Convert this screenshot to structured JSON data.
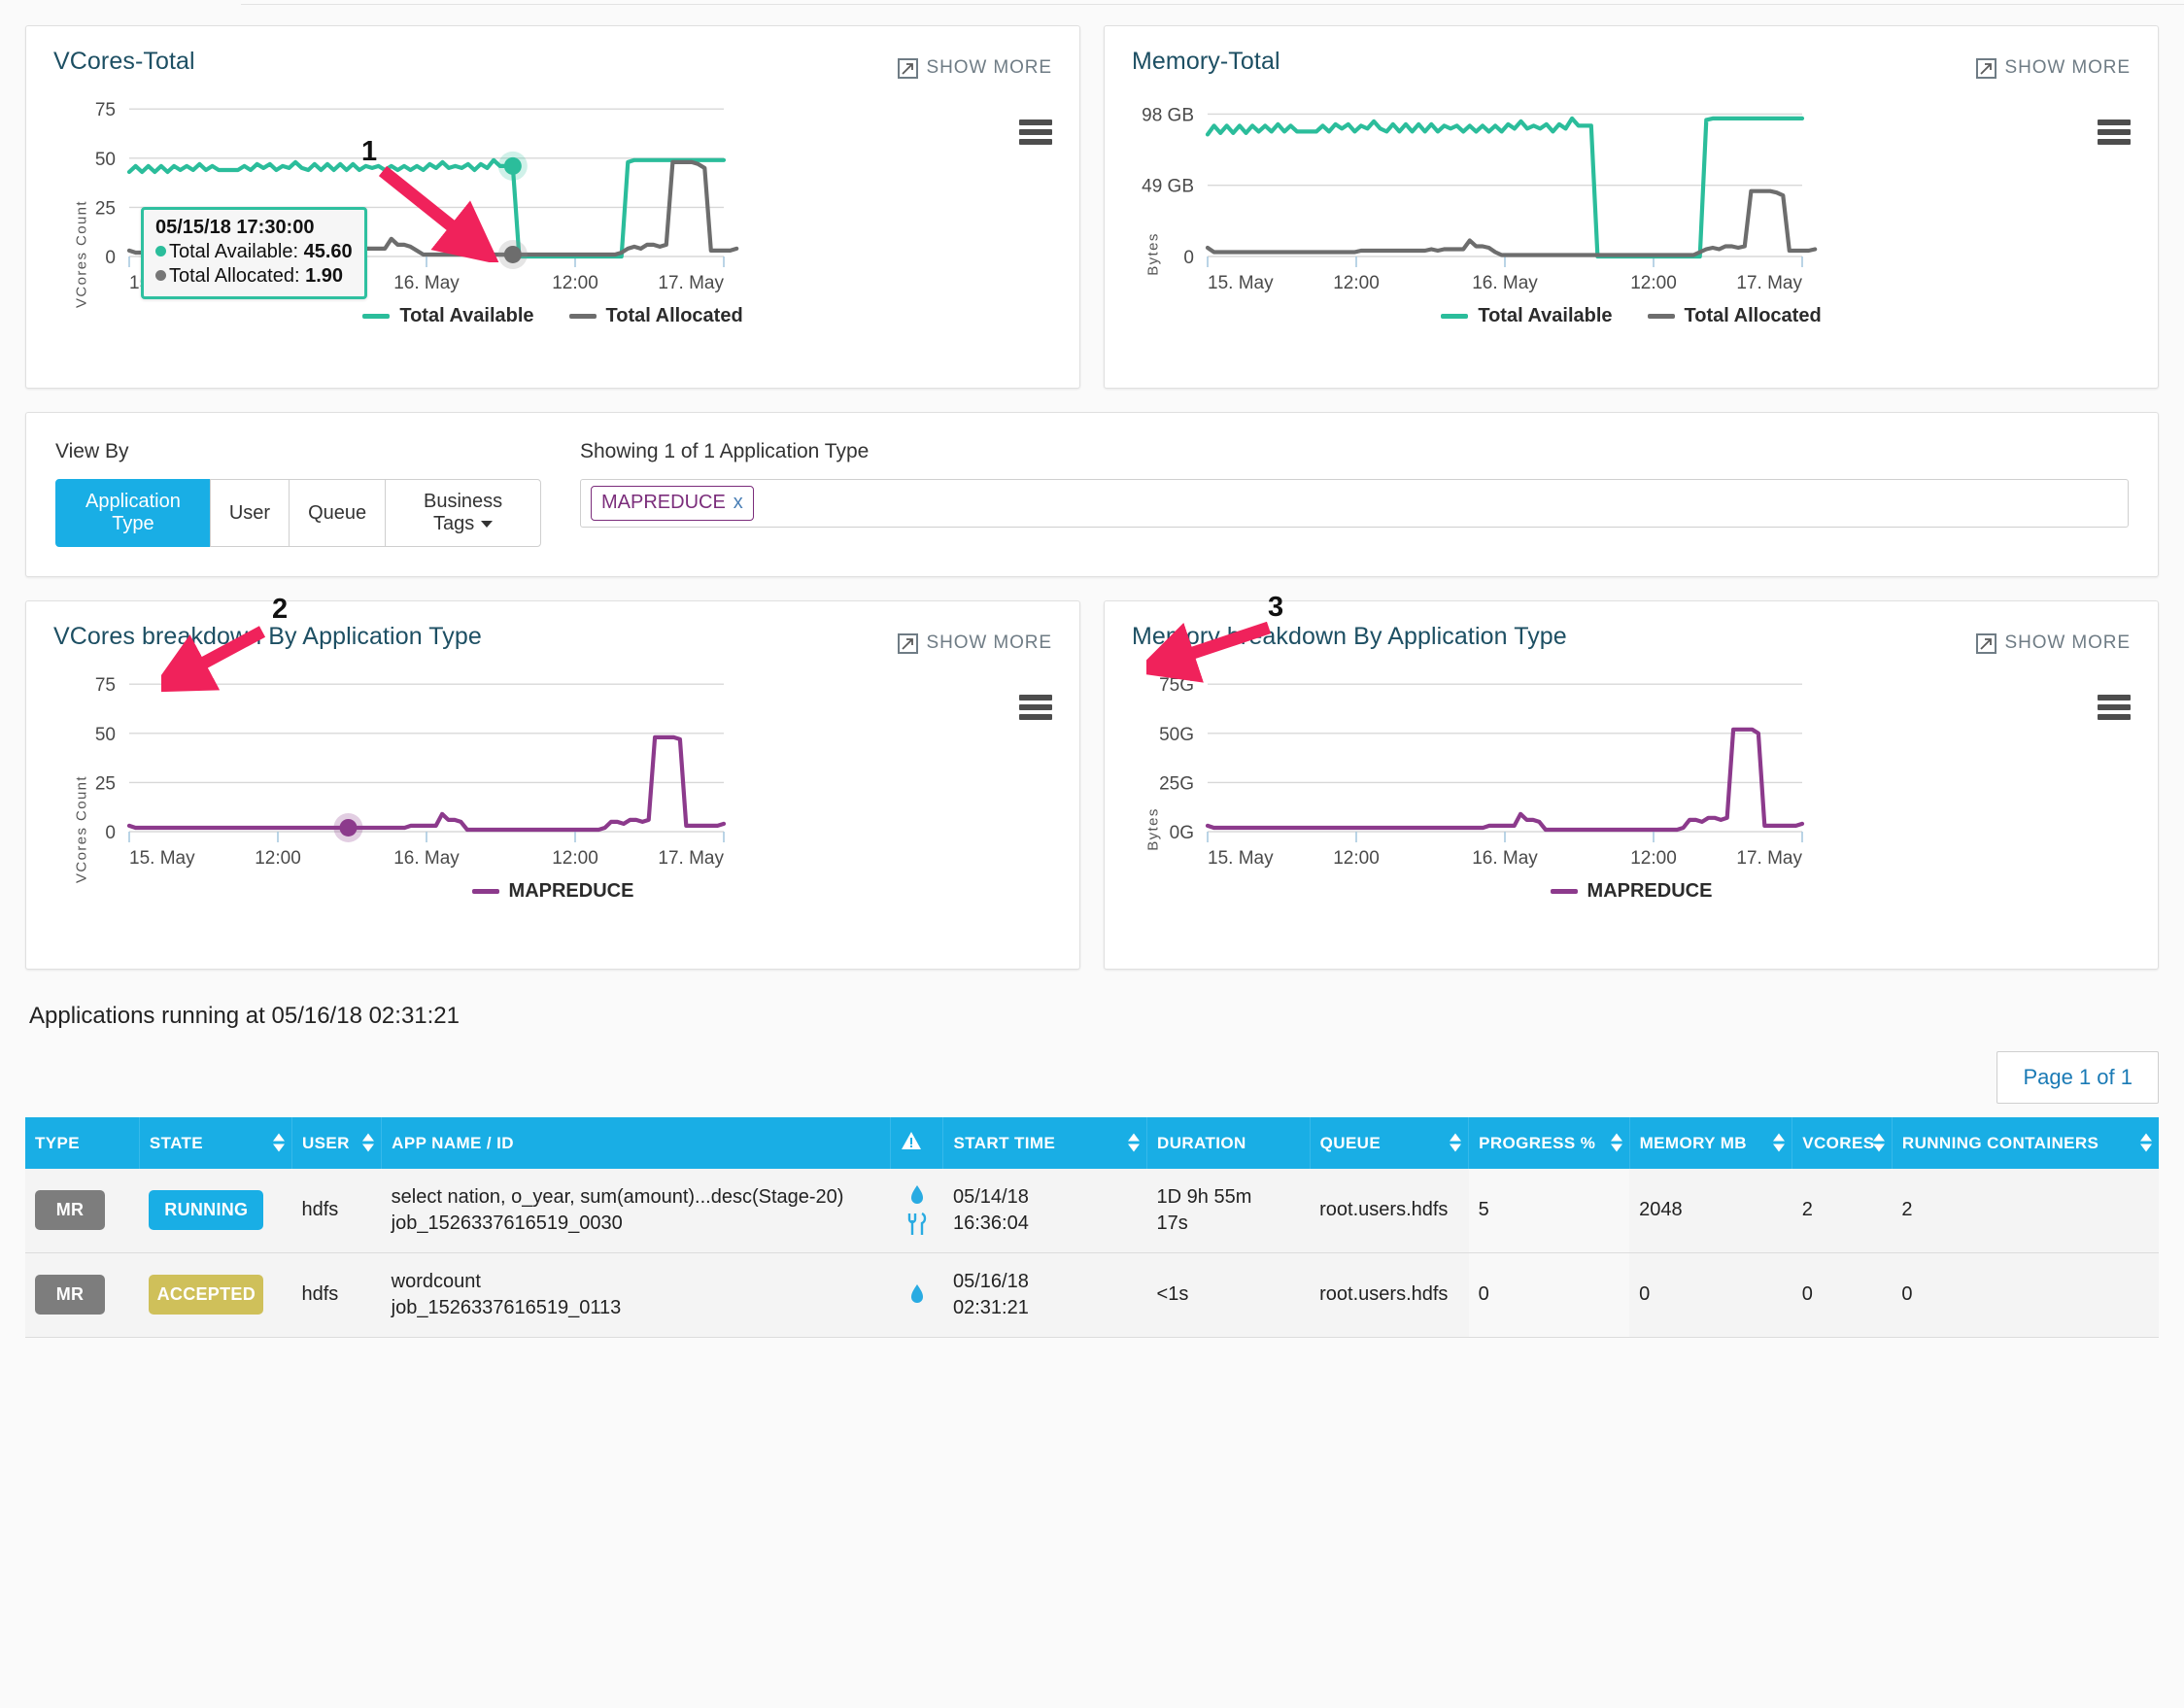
{
  "panels": {
    "vcores_total": {
      "title": "VCores-Total",
      "show_more": "SHOW MORE",
      "menu_icon": "hamburger-icon"
    },
    "memory_total": {
      "title": "Memory-Total",
      "show_more": "SHOW MORE",
      "menu_icon": "hamburger-icon"
    },
    "vcores_breakdown": {
      "title": "VCores breakdown By Application Type",
      "show_more": "SHOW MORE",
      "menu_icon": "hamburger-icon"
    },
    "memory_breakdown": {
      "title": "Memory breakdown By Application Type",
      "show_more": "SHOW MORE",
      "menu_icon": "hamburger-icon"
    }
  },
  "tooltip": {
    "time": "05/15/18 17:30:00",
    "series1_label": "Total Available:",
    "series1_value": "45.60",
    "series2_label": "Total Allocated:",
    "series2_value": "1.90"
  },
  "annotations": [
    {
      "number": "1"
    },
    {
      "number": "2"
    },
    {
      "number": "3"
    }
  ],
  "view_by": {
    "label": "View By",
    "buttons": [
      {
        "label": "Application Type",
        "active": true
      },
      {
        "label": "User",
        "active": false
      },
      {
        "label": "Queue",
        "active": false
      },
      {
        "label": "Business Tags",
        "active": false,
        "has_caret": true
      }
    ],
    "showing_label": "Showing 1 of 1 Application Type",
    "tokens": [
      {
        "label": "MAPREDUCE",
        "remove": "x"
      }
    ]
  },
  "apps": {
    "heading": "Applications running at 05/16/18 02:31:21",
    "pager": "Page 1 of 1",
    "columns": [
      {
        "label": "TYPE",
        "sortable": false
      },
      {
        "label": "STATE",
        "sortable": true
      },
      {
        "label": "USER",
        "sortable": true
      },
      {
        "label": "APP NAME / ID",
        "sortable": false
      },
      {
        "label": "",
        "icon": "warning-icon",
        "sortable": false
      },
      {
        "label": "START TIME",
        "sortable": true
      },
      {
        "label": "DURATION",
        "sortable": false
      },
      {
        "label": "QUEUE",
        "sortable": true
      },
      {
        "label": "PROGRESS %",
        "sortable": true
      },
      {
        "label": "MEMORY MB",
        "sortable": true
      },
      {
        "label": "VCORES",
        "sortable": true
      },
      {
        "label": "RUNNING CONTAINERS",
        "sortable": true
      }
    ],
    "rows": [
      {
        "type": "MR",
        "state": "RUNNING",
        "state_style": "running",
        "user": "hdfs",
        "app_name": "select nation, o_year, sum(amount)...desc(Stage-20)",
        "app_id": "job_1526337616519_0030",
        "icons": [
          "info-icon",
          "tools-icon"
        ],
        "start_date": "05/14/18",
        "start_time": "16:36:04",
        "duration_line1": "1D 9h 55m",
        "duration_line2": "17s",
        "queue": "root.users.hdfs",
        "progress": "5",
        "memory_mb": "2048",
        "vcores": "2",
        "running_containers": "2"
      },
      {
        "type": "MR",
        "state": "ACCEPTED",
        "state_style": "accepted",
        "user": "hdfs",
        "app_name": "wordcount",
        "app_id": "job_1526337616519_0113",
        "icons": [
          "info-icon"
        ],
        "start_date": "05/16/18",
        "start_time": "02:31:21",
        "duration_line1": "<1s",
        "duration_line2": "",
        "queue": "root.users.hdfs",
        "progress": "0",
        "memory_mb": "0",
        "vcores": "0",
        "running_containers": "0"
      }
    ]
  },
  "colors": {
    "teal": "#2bbd9b",
    "gray_line": "#6d6d6d",
    "purple": "#8c3a8c",
    "accent_blue": "#19aee5",
    "annotation_pink": "#f0225b",
    "title_blue": "#1d4f63"
  },
  "chart_data": [
    {
      "id": "vcores_total",
      "type": "line",
      "title": "VCores-Total",
      "xlabel": "",
      "ylabel": "VCores Count",
      "ylim": [
        0,
        85
      ],
      "yticks": [
        0,
        25,
        50,
        75
      ],
      "ytick_labels": [
        "0",
        "25",
        "50",
        "75"
      ],
      "xticks": [
        0,
        0.25,
        0.5,
        0.75,
        1.0
      ],
      "xtick_labels": [
        "15. May",
        "12:00",
        "16. May",
        "12:00",
        "17. May"
      ],
      "grid": true,
      "legend_position": "bottom",
      "highlight_point": {
        "x_label": "05/15/18 17:30:00",
        "available": 45.6,
        "allocated": 1.9
      },
      "series": [
        {
          "name": "Total Available",
          "color": "#2bbd9b",
          "values": [
            43,
            46,
            43,
            46,
            43,
            46,
            43,
            46,
            44,
            46,
            44,
            47,
            44,
            46,
            44,
            44,
            44,
            44,
            46,
            44,
            47,
            45,
            47,
            44,
            46,
            45,
            48,
            45,
            44,
            47,
            44,
            47,
            44,
            47,
            44,
            47,
            44,
            46,
            45,
            46,
            44,
            46,
            44,
            46,
            44,
            46,
            44,
            47,
            45,
            48,
            45,
            46,
            45,
            47,
            44,
            47,
            45,
            49,
            46,
            46,
            46,
            0,
            0,
            0,
            0,
            0,
            0,
            0,
            0,
            0,
            0,
            0,
            0,
            0,
            0,
            0,
            0,
            0,
            48,
            49,
            49,
            49,
            49,
            49,
            49,
            49,
            49,
            49,
            49,
            49,
            49,
            49,
            49,
            49
          ]
        },
        {
          "name": "Total Allocated",
          "color": "#6d6d6d",
          "values": [
            3,
            2,
            2,
            2,
            2,
            2,
            2,
            2,
            2,
            2,
            2,
            2,
            2,
            2,
            2,
            2,
            2,
            2,
            2,
            2,
            2,
            2,
            2,
            2,
            3,
            3,
            3,
            3,
            3,
            3,
            3,
            3,
            3,
            3,
            3,
            4,
            3,
            4,
            4,
            4,
            4,
            9,
            6,
            6,
            5,
            3,
            1,
            1,
            1,
            1,
            1,
            1,
            1,
            1,
            1,
            1,
            1,
            1,
            1,
            1,
            1,
            1,
            1,
            1,
            1,
            1,
            1,
            1,
            1,
            1,
            1,
            1,
            1,
            1,
            1,
            1,
            1,
            2,
            4,
            5,
            4,
            6,
            6,
            5,
            6,
            48,
            48,
            48,
            48,
            47,
            45,
            3,
            3,
            3,
            3,
            4
          ]
        }
      ]
    },
    {
      "id": "memory_total",
      "type": "line",
      "title": "Memory-Total",
      "xlabel": "",
      "ylabel": "Bytes",
      "ylim": [
        0,
        115
      ],
      "yticks": [
        0,
        49,
        98
      ],
      "ytick_labels": [
        "0",
        "49 GB",
        "98 GB"
      ],
      "xticks": [
        0,
        0.25,
        0.5,
        0.75,
        1.0
      ],
      "xtick_labels": [
        "15. May",
        "12:00",
        "16. May",
        "12:00",
        "17. May"
      ],
      "grid": true,
      "legend_position": "bottom",
      "series": [
        {
          "name": "Total Available",
          "color": "#2bbd9b",
          "values": [
            84,
            90,
            85,
            90,
            85,
            90,
            85,
            90,
            86,
            90,
            86,
            91,
            86,
            90,
            86,
            86,
            86,
            86,
            90,
            86,
            91,
            88,
            91,
            86,
            90,
            88,
            93,
            88,
            86,
            91,
            86,
            91,
            86,
            91,
            86,
            91,
            86,
            90,
            88,
            90,
            86,
            90,
            86,
            90,
            86,
            90,
            86,
            91,
            88,
            93,
            88,
            90,
            88,
            91,
            86,
            91,
            88,
            95,
            90,
            90,
            90,
            0,
            0,
            0,
            0,
            0,
            0,
            0,
            0,
            0,
            0,
            0,
            0,
            0,
            0,
            0,
            0,
            0,
            94,
            95,
            95,
            95,
            95,
            95,
            95,
            95,
            95,
            95,
            95,
            95,
            95,
            95,
            95,
            95
          ]
        },
        {
          "name": "Total Allocated",
          "color": "#6d6d6d",
          "values": [
            6,
            3,
            3,
            3,
            3,
            3,
            3,
            3,
            3,
            3,
            3,
            3,
            3,
            3,
            3,
            3,
            3,
            3,
            3,
            3,
            3,
            3,
            3,
            3,
            4,
            4,
            4,
            4,
            4,
            4,
            4,
            4,
            4,
            4,
            4,
            5,
            4,
            5,
            5,
            5,
            5,
            11,
            7,
            7,
            6,
            3,
            1,
            1,
            1,
            1,
            1,
            1,
            1,
            1,
            1,
            1,
            1,
            1,
            1,
            1,
            1,
            1,
            1,
            1,
            1,
            1,
            1,
            1,
            1,
            1,
            1,
            1,
            1,
            1,
            1,
            1,
            1,
            3,
            5,
            6,
            5,
            7,
            7,
            6,
            7,
            45,
            45,
            45,
            45,
            44,
            42,
            4,
            4,
            4,
            4,
            5
          ]
        }
      ]
    },
    {
      "id": "vcores_breakdown",
      "type": "line",
      "title": "VCores breakdown By Application Type",
      "xlabel": "",
      "ylabel": "VCores Count",
      "ylim": [
        0,
        85
      ],
      "yticks": [
        0,
        25,
        50,
        75
      ],
      "ytick_labels": [
        "0",
        "25",
        "50",
        "75"
      ],
      "xticks": [
        0,
        0.25,
        0.5,
        0.75,
        1.0
      ],
      "xtick_labels": [
        "15. May",
        "12:00",
        "16. May",
        "12:00",
        "17. May"
      ],
      "grid": true,
      "legend_position": "bottom",
      "highlight_point": {
        "index": 35,
        "value": 2
      },
      "series": [
        {
          "name": "MAPREDUCE",
          "color": "#8c3a8c",
          "values": [
            3,
            2,
            2,
            2,
            2,
            2,
            2,
            2,
            2,
            2,
            2,
            2,
            2,
            2,
            2,
            2,
            2,
            2,
            2,
            2,
            2,
            2,
            2,
            2,
            2,
            2,
            2,
            2,
            2,
            2,
            2,
            2,
            2,
            2,
            2,
            2,
            2,
            2,
            2,
            2,
            2,
            2,
            2,
            2,
            2,
            3,
            3,
            3,
            3,
            3,
            9,
            6,
            6,
            5,
            1,
            1,
            1,
            1,
            1,
            1,
            1,
            1,
            1,
            1,
            1,
            1,
            1,
            1,
            1,
            1,
            1,
            1,
            1,
            1,
            1,
            1,
            2,
            5,
            5,
            4,
            6,
            6,
            5,
            6,
            48,
            48,
            48,
            48,
            47,
            3,
            3,
            3,
            3,
            3,
            3,
            4
          ]
        }
      ]
    },
    {
      "id": "memory_breakdown",
      "type": "line",
      "title": "Memory breakdown By Application Type",
      "xlabel": "",
      "ylabel": "Bytes",
      "ylim": [
        0,
        85
      ],
      "yticks": [
        0,
        25,
        50,
        75
      ],
      "ytick_labels": [
        "0G",
        "25G",
        "50G",
        "75G"
      ],
      "xticks": [
        0,
        0.25,
        0.5,
        0.75,
        1.0
      ],
      "xtick_labels": [
        "15. May",
        "12:00",
        "16. May",
        "12:00",
        "17. May"
      ],
      "grid": true,
      "legend_position": "bottom",
      "series": [
        {
          "name": "MAPREDUCE",
          "color": "#8c3a8c",
          "values": [
            3,
            2,
            2,
            2,
            2,
            2,
            2,
            2,
            2,
            2,
            2,
            2,
            2,
            2,
            2,
            2,
            2,
            2,
            2,
            2,
            2,
            2,
            2,
            2,
            2,
            2,
            2,
            2,
            2,
            2,
            2,
            2,
            2,
            2,
            2,
            2,
            2,
            2,
            2,
            2,
            2,
            2,
            2,
            2,
            2,
            3,
            3,
            3,
            3,
            3,
            9,
            6,
            6,
            5,
            1,
            1,
            1,
            1,
            1,
            1,
            1,
            1,
            1,
            1,
            1,
            1,
            1,
            1,
            1,
            1,
            1,
            1,
            1,
            1,
            1,
            1,
            2,
            6,
            6,
            5,
            7,
            7,
            6,
            7,
            52,
            52,
            52,
            52,
            50,
            3,
            3,
            3,
            3,
            3,
            3,
            4
          ]
        }
      ]
    }
  ]
}
